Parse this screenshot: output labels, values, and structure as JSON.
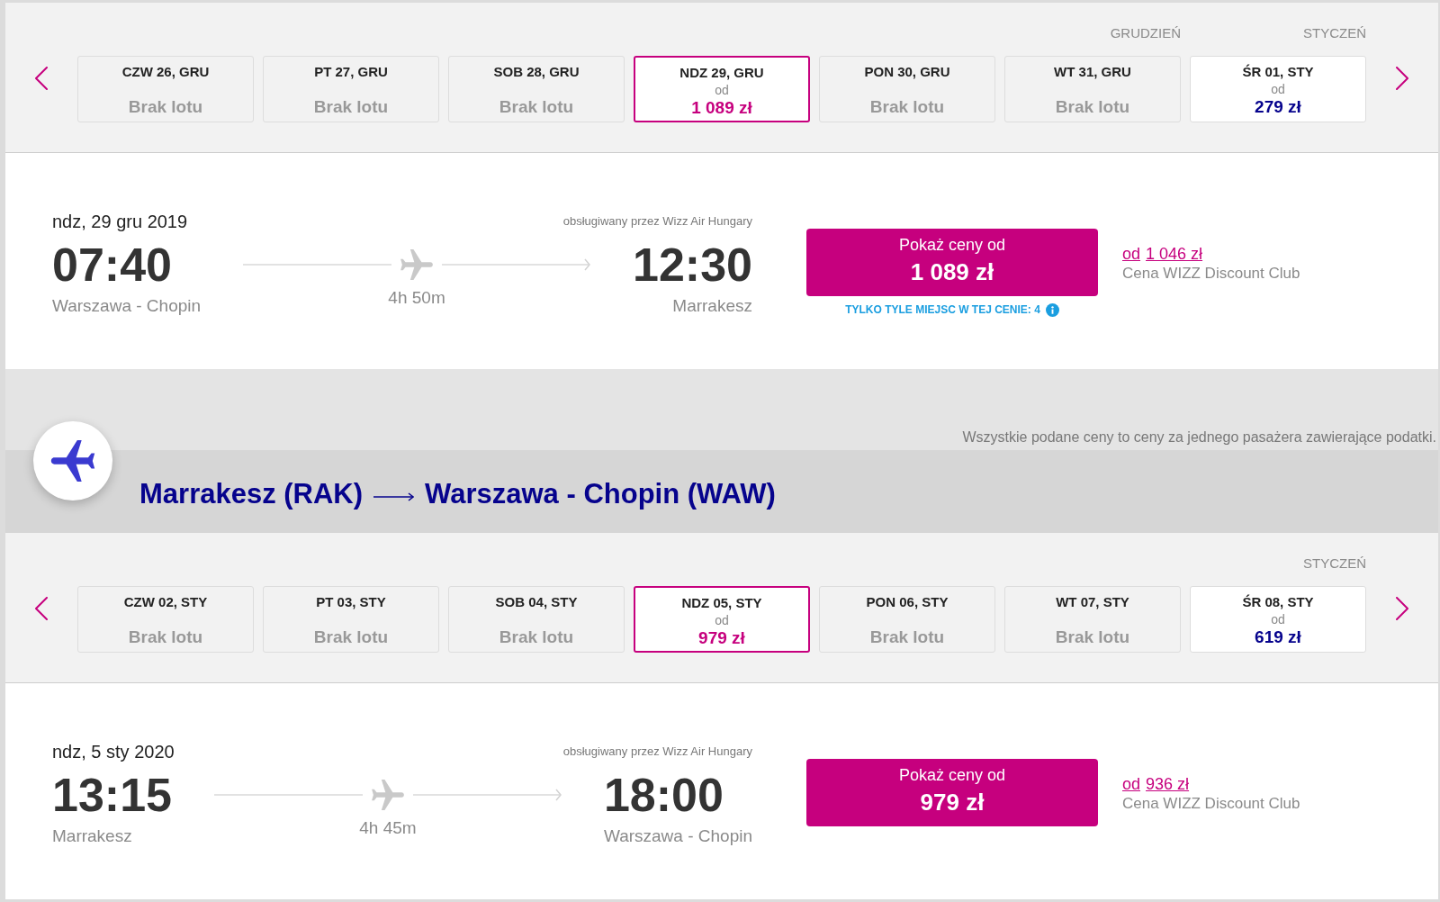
{
  "outbound": {
    "date_strip": {
      "cards": [
        {
          "kind": "unavailable",
          "day": "CZW 26, GRU",
          "status": "Brak lotu",
          "selected": false
        },
        {
          "kind": "unavailable",
          "day": "PT 27, GRU",
          "status": "Brak lotu",
          "selected": false
        },
        {
          "kind": "unavailable",
          "day": "SOB 28, GRU",
          "status": "Brak lotu",
          "selected": false
        },
        {
          "kind": "priced",
          "day": "NDZ 29, GRU",
          "from": "od",
          "price": "1 089 zł",
          "selected": true
        },
        {
          "kind": "unavailable",
          "day": "PON 30, GRU",
          "status": "Brak lotu",
          "selected": false
        },
        {
          "kind": "unavailable",
          "month": "GRUDZIEŃ",
          "day": "WT 31, GRU",
          "status": "Brak lotu",
          "selected": false
        },
        {
          "kind": "priced",
          "month": "STYCZEŃ",
          "day": "ŚR 01, STY",
          "from": "od",
          "price": "279 zł",
          "selected": false
        }
      ]
    },
    "flight": {
      "date": "ndz, 29 gru 2019",
      "operator": "obsługiwany przez Wizz Air Hungary",
      "departure": {
        "time": "07:40",
        "station": "Warszawa - Chopin"
      },
      "duration": "4h 50m",
      "arrival": {
        "time": "12:30",
        "station": "Marrakesz"
      },
      "price_button": {
        "label": "Pokaż ceny od",
        "price": "1 089 zł"
      },
      "seats_notice": "TYLKO TYLE MIEJSC W TEJ CENIE: 4",
      "discount": {
        "prefix": "od",
        "price": "1 046 zł",
        "label": "Cena WIZZ Discount Club"
      }
    }
  },
  "price_note": "Wszystkie podane ceny to ceny za jednego pasażera zawierające podatki.",
  "return": {
    "route": {
      "origin": "Marrakesz (RAK)",
      "destination": "Warszawa - Chopin (WAW)"
    },
    "date_strip": {
      "cards": [
        {
          "kind": "unavailable",
          "day": "CZW 02, STY",
          "status": "Brak lotu",
          "selected": false
        },
        {
          "kind": "unavailable",
          "day": "PT 03, STY",
          "status": "Brak lotu",
          "selected": false
        },
        {
          "kind": "unavailable",
          "day": "SOB 04, STY",
          "status": "Brak lotu",
          "selected": false
        },
        {
          "kind": "priced",
          "day": "NDZ 05, STY",
          "from": "od",
          "price": "979 zł",
          "selected": true
        },
        {
          "kind": "unavailable",
          "day": "PON 06, STY",
          "status": "Brak lotu",
          "selected": false
        },
        {
          "kind": "unavailable",
          "day": "WT 07, STY",
          "status": "Brak lotu",
          "selected": false
        },
        {
          "kind": "priced",
          "month": "STYCZEŃ",
          "day": "ŚR 08, STY",
          "from": "od",
          "price": "619 zł",
          "selected": false
        }
      ]
    },
    "flight": {
      "date": "ndz, 5 sty 2020",
      "operator": "obsługiwany przez Wizz Air Hungary",
      "departure": {
        "time": "13:15",
        "station": "Marrakesz"
      },
      "duration": "4h 45m",
      "arrival": {
        "time": "18:00",
        "station": "Warszawa - Chopin"
      },
      "price_button": {
        "label": "Pokaż ceny od",
        "price": "979 zł"
      },
      "discount": {
        "prefix": "od",
        "price": "936 zł",
        "label": "Cena WIZZ Discount Club"
      }
    }
  }
}
